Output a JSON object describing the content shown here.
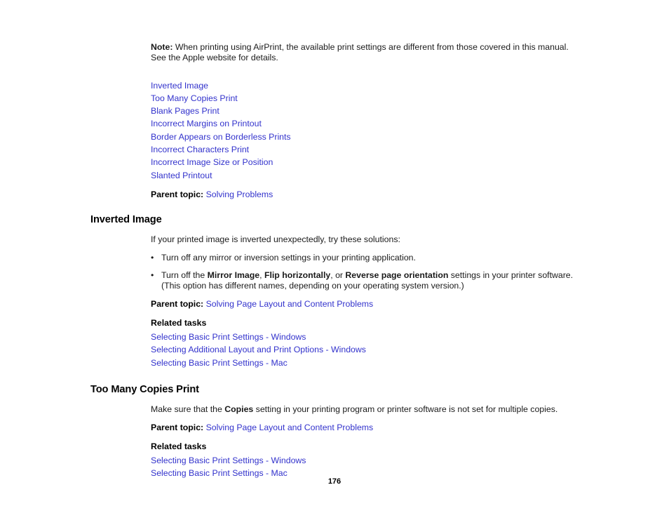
{
  "document": {
    "page_number": "176"
  },
  "note": {
    "label": "Note:",
    "text": " When printing using AirPrint, the available print settings are different from those covered in this manual. See the Apple website for details."
  },
  "topic_links": [
    {
      "label": "Inverted Image"
    },
    {
      "label": "Too Many Copies Print"
    },
    {
      "label": "Blank Pages Print"
    },
    {
      "label": "Incorrect Margins on Printout"
    },
    {
      "label": "Border Appears on Borderless Prints"
    },
    {
      "label": "Incorrect Characters Print"
    },
    {
      "label": "Incorrect Image Size or Position"
    },
    {
      "label": "Slanted Printout"
    }
  ],
  "intro_parent_topic": {
    "label": "Parent topic:",
    "link": "Solving Problems"
  },
  "sections": [
    {
      "title": "Inverted Image",
      "intro": "If your printed image is inverted unexpectedly, try these solutions:",
      "bullets": [
        {
          "marker": "•",
          "parts": [
            {
              "type": "text",
              "value": "Turn off any mirror or inversion settings in your printing application."
            }
          ]
        },
        {
          "marker": "•",
          "parts": [
            {
              "type": "text",
              "value": "Turn off the "
            },
            {
              "type": "bold",
              "value": "Mirror Image"
            },
            {
              "type": "text",
              "value": ", "
            },
            {
              "type": "bold",
              "value": "Flip horizontally"
            },
            {
              "type": "text",
              "value": ", or "
            },
            {
              "type": "bold",
              "value": "Reverse page orientation"
            },
            {
              "type": "text",
              "value": " settings in your printer software. (This option has different names, depending on your operating system version.)"
            }
          ]
        }
      ],
      "parent_topic": {
        "label": "Parent topic:",
        "link": "Solving Page Layout and Content Problems"
      },
      "related_tasks": {
        "heading": "Related tasks",
        "links": [
          {
            "label": "Selecting Basic Print Settings - Windows"
          },
          {
            "label": "Selecting Additional Layout and Print Options - Windows"
          },
          {
            "label": "Selecting Basic Print Settings - Mac"
          }
        ]
      }
    },
    {
      "title": "Too Many Copies Print",
      "paragraph": [
        {
          "type": "text",
          "value": "Make sure that the "
        },
        {
          "type": "bold",
          "value": "Copies"
        },
        {
          "type": "text",
          "value": " setting in your printing program or printer software is not set for multiple copies."
        }
      ],
      "parent_topic": {
        "label": "Parent topic:",
        "link": "Solving Page Layout and Content Problems"
      },
      "related_tasks": {
        "heading": "Related tasks",
        "links": [
          {
            "label": "Selecting Basic Print Settings - Windows"
          },
          {
            "label": "Selecting Basic Print Settings - Mac"
          }
        ]
      }
    }
  ],
  "colors": {
    "link": "#3232cc",
    "text": "#1a1a1a",
    "background": "#ffffff"
  }
}
